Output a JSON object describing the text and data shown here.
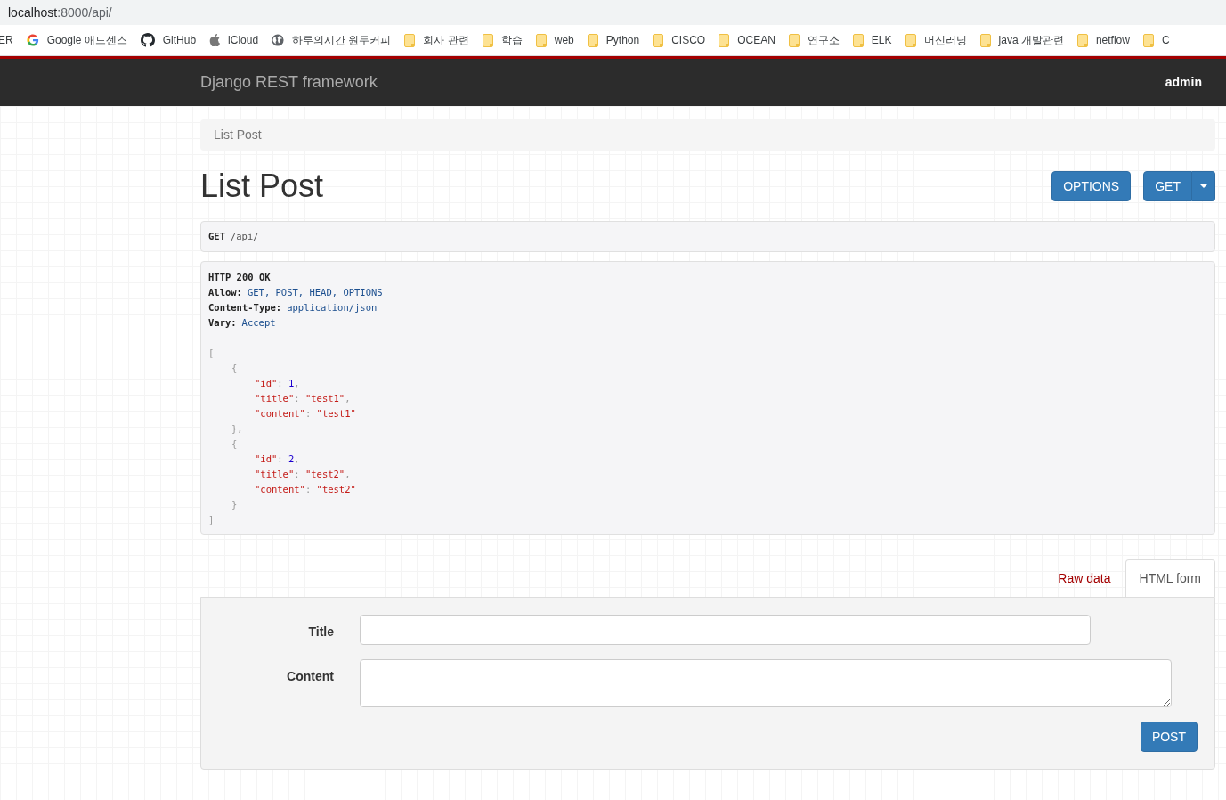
{
  "browser": {
    "url_host": "localhost",
    "url_path": ":8000/api/"
  },
  "bookmarks": [
    {
      "label": "ER",
      "kind": "text"
    },
    {
      "label": "Google 애드센스",
      "kind": "google"
    },
    {
      "label": "GitHub",
      "kind": "github"
    },
    {
      "label": "iCloud",
      "kind": "apple"
    },
    {
      "label": "하루의시간 원두커피",
      "kind": "globe"
    },
    {
      "label": "회사 관련",
      "kind": "folder"
    },
    {
      "label": "학습",
      "kind": "folder"
    },
    {
      "label": "web",
      "kind": "folder"
    },
    {
      "label": "Python",
      "kind": "folder"
    },
    {
      "label": "CISCO",
      "kind": "folder"
    },
    {
      "label": "OCEAN",
      "kind": "folder"
    },
    {
      "label": "연구소",
      "kind": "folder"
    },
    {
      "label": "ELK",
      "kind": "folder"
    },
    {
      "label": "머신러닝",
      "kind": "folder"
    },
    {
      "label": "java 개발관련",
      "kind": "folder"
    },
    {
      "label": "netflow",
      "kind": "folder"
    },
    {
      "label": "C",
      "kind": "folder"
    }
  ],
  "navbar": {
    "brand": "Django REST framework",
    "user": "admin"
  },
  "breadcrumb": [
    "List Post"
  ],
  "page_title": "List Post",
  "actions": {
    "options": "OPTIONS",
    "get": "GET"
  },
  "request": {
    "method": "GET",
    "path": "/api/"
  },
  "response": {
    "status": "HTTP 200 OK",
    "headers": [
      {
        "name": "Allow:",
        "value": "GET, POST, HEAD, OPTIONS"
      },
      {
        "name": "Content-Type:",
        "value": "application/json"
      },
      {
        "name": "Vary:",
        "value": "Accept"
      }
    ],
    "body": {
      "open": "[",
      "close": "]",
      "children": [
        {
          "open": "{",
          "close": "},",
          "lines": [
            [
              {
                "text": "\"id\"",
                "kind": "key"
              },
              {
                "text": ": ",
                "kind": "punct"
              },
              {
                "text": "1",
                "kind": "number"
              },
              {
                "text": ",",
                "kind": "punct"
              }
            ],
            [
              {
                "text": "\"title\"",
                "kind": "key"
              },
              {
                "text": ": ",
                "kind": "punct"
              },
              {
                "text": "\"test1\"",
                "kind": "string"
              },
              {
                "text": ",",
                "kind": "punct"
              }
            ],
            [
              {
                "text": "\"content\"",
                "kind": "key"
              },
              {
                "text": ": ",
                "kind": "punct"
              },
              {
                "text": "\"test1\"",
                "kind": "string"
              }
            ]
          ]
        },
        {
          "open": "{",
          "close": "}",
          "lines": [
            [
              {
                "text": "\"id\"",
                "kind": "key"
              },
              {
                "text": ": ",
                "kind": "punct"
              },
              {
                "text": "2",
                "kind": "number"
              },
              {
                "text": ",",
                "kind": "punct"
              }
            ],
            [
              {
                "text": "\"title\"",
                "kind": "key"
              },
              {
                "text": ": ",
                "kind": "punct"
              },
              {
                "text": "\"test2\"",
                "kind": "string"
              },
              {
                "text": ",",
                "kind": "punct"
              }
            ],
            [
              {
                "text": "\"content\"",
                "kind": "key"
              },
              {
                "text": ": ",
                "kind": "punct"
              },
              {
                "text": "\"test2\"",
                "kind": "string"
              }
            ]
          ]
        }
      ]
    }
  },
  "form_tabs": [
    {
      "label": "Raw data",
      "selected": false
    },
    {
      "label": "HTML form",
      "selected": true
    }
  ],
  "form": {
    "fields": [
      {
        "label": "Title",
        "kind": "input"
      },
      {
        "label": "Content",
        "kind": "textarea"
      }
    ],
    "submit": "POST"
  }
}
